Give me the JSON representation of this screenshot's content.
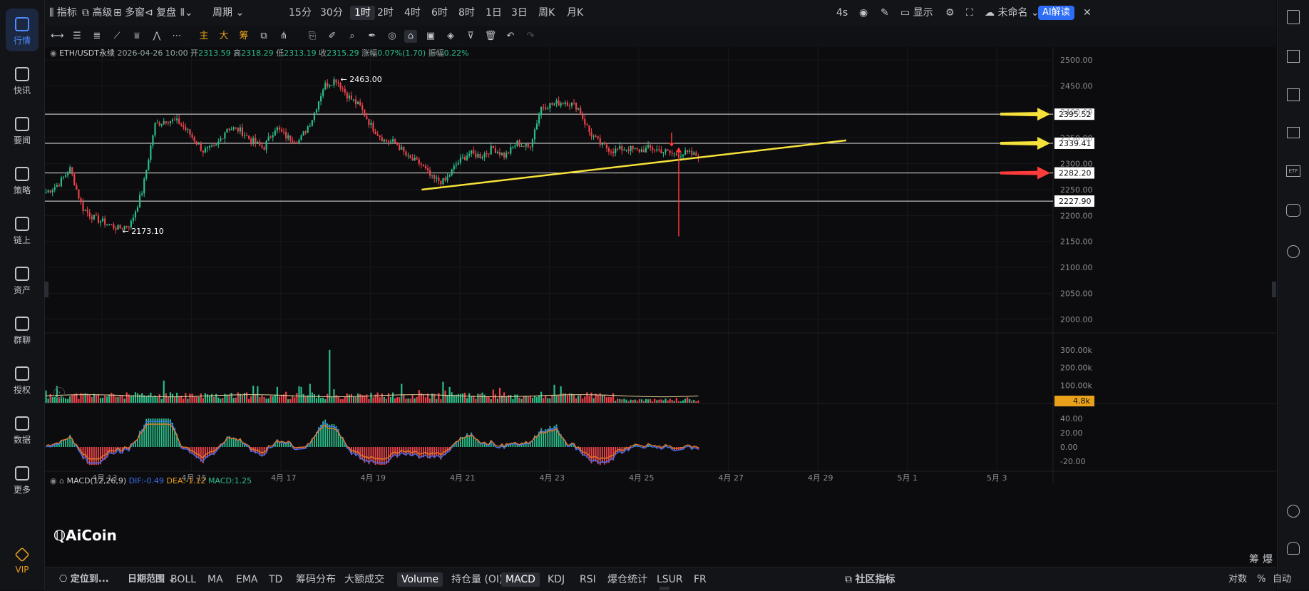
{
  "left_nav": [
    {
      "label": "行情",
      "icon": "bar-chart-icon",
      "active": true
    },
    {
      "label": "快讯",
      "icon": "flash-news-icon"
    },
    {
      "label": "要闻",
      "icon": "document-icon"
    },
    {
      "label": "策略",
      "icon": "robot-icon"
    },
    {
      "label": "链上",
      "icon": "chain-icon"
    },
    {
      "label": "资产",
      "icon": "wallet-icon"
    },
    {
      "label": "群聊",
      "icon": "chat-icon"
    },
    {
      "label": "授权",
      "icon": "authorize-icon"
    },
    {
      "label": "数据",
      "icon": "data-monitor-icon"
    },
    {
      "label": "更多",
      "icon": "more-grid-icon"
    },
    {
      "label": "VIP",
      "icon": "diamond-icon"
    }
  ],
  "top_toolbar": {
    "indicators": "指标",
    "advanced": "高级",
    "multi_window": "多窗",
    "replay": "复盘",
    "period": "周期",
    "timeframes": [
      "15分",
      "30分",
      "1时",
      "2时",
      "4时",
      "6时",
      "8时",
      "1日",
      "3日",
      "周K",
      "月K"
    ],
    "selected_timeframe": "1时",
    "refresh": "4s",
    "display": "显示",
    "layout_name": "未命名",
    "ai_button": "AI解读"
  },
  "instrument": {
    "symbol": "ETH/USDT永续",
    "datetime": "2026-04-26 10:00",
    "open_label": "开",
    "open": "2313.59",
    "high_label": "高",
    "high": "2318.29",
    "low_label": "低",
    "low": "2313.19",
    "close_label": "收",
    "close": "2315.29",
    "change_label": "涨幅",
    "change": "0.07%(1.70)",
    "amplitude_label": "振幅",
    "amplitude": "0.22%"
  },
  "chart_data": {
    "type": "candlestick",
    "interval": "1h",
    "x_labels": [
      "4月 13",
      "4月 15",
      "4月 17",
      "4月 19",
      "4月 21",
      "4月 23",
      "4月 25",
      "4月 27",
      "4月 29",
      "5月 1",
      "5月 3"
    ],
    "y_ticks": [
      2000,
      2050,
      2100,
      2150,
      2200,
      2250,
      2300,
      2350,
      2400,
      2450,
      2500
    ],
    "ylim": [
      1975,
      2525
    ],
    "close_path": [
      [
        "4月 12",
        2245
      ],
      [
        "4月 13",
        2260
      ],
      [
        "4月 13",
        2290
      ],
      [
        "4月 13",
        2215
      ],
      [
        "4月 13",
        2195
      ],
      [
        "4月 14",
        2185
      ],
      [
        "4月 14",
        2175
      ],
      [
        "4月 14",
        2183
      ],
      [
        "4月 14",
        2250
      ],
      [
        "4月 14",
        2375
      ],
      [
        "4月 15",
        2385
      ],
      [
        "4月 15",
        2380
      ],
      [
        "4月 15",
        2355
      ],
      [
        "4月 15",
        2325
      ],
      [
        "4月 16",
        2330
      ],
      [
        "4月 16",
        2370
      ],
      [
        "4月 16",
        2365
      ],
      [
        "4月 16",
        2345
      ],
      [
        "4月 17",
        2330
      ],
      [
        "4月 17",
        2370
      ],
      [
        "4月 17",
        2350
      ],
      [
        "4月 17",
        2345
      ],
      [
        "4月 18",
        2385
      ],
      [
        "4月 18",
        2450
      ],
      [
        "4月 18",
        2463
      ],
      [
        "4月 18",
        2430
      ],
      [
        "4月 18",
        2410
      ],
      [
        "4月 19",
        2370
      ],
      [
        "4月 19",
        2345
      ],
      [
        "4月 19",
        2340
      ],
      [
        "4月 20",
        2310
      ],
      [
        "4月 20",
        2300
      ],
      [
        "4月 20",
        2270
      ],
      [
        "4月 20",
        2265
      ],
      [
        "4月 21",
        2300
      ],
      [
        "4月 21",
        2320
      ],
      [
        "4月 21",
        2315
      ],
      [
        "4月 22",
        2330
      ],
      [
        "4月 22",
        2315
      ],
      [
        "4月 22",
        2340
      ],
      [
        "4月 22",
        2330
      ],
      [
        "4月 22",
        2410
      ],
      [
        "4月 23",
        2415
      ],
      [
        "4月 23",
        2420
      ],
      [
        "4月 23",
        2410
      ],
      [
        "4月 23",
        2360
      ],
      [
        "4月 24",
        2335
      ],
      [
        "4月 24",
        2325
      ],
      [
        "4月 24",
        2330
      ],
      [
        "4月 24",
        2325
      ],
      [
        "4月 25",
        2330
      ],
      [
        "4月 25",
        2325
      ],
      [
        "4月 25",
        2318
      ],
      [
        "4月 26",
        2320
      ],
      [
        "4月 26",
        2315
      ]
    ],
    "annotations": {
      "high_label": "2463.00",
      "high_value": 2463.0,
      "low_label": "2173.10",
      "low_value": 2173.1
    },
    "horizontal_levels": [
      {
        "value": 2395.52,
        "label": "2395.52",
        "arrow_color": "#f5e13a"
      },
      {
        "value": 2339.41,
        "label": "2339.41",
        "arrow_color": "#f5e13a"
      },
      {
        "value": 2282.2,
        "label": "2282.20",
        "arrow_color": "#ff3b3b"
      },
      {
        "value": 2227.9,
        "label": "2227.90",
        "arrow_color": null
      }
    ],
    "trendline": {
      "from": [
        "4月 20",
        2250
      ],
      "to": [
        "4月 29",
        2345
      ],
      "color": "#f5e13a"
    },
    "vertical_marker": {
      "x": "4月 26",
      "top": 2360,
      "bottom": 2160,
      "color": "#ff3b3b"
    },
    "volume": {
      "y_ticks": [
        "300.00k",
        "200.00k",
        "100.00k"
      ],
      "current": "4.8k"
    },
    "macd": {
      "label": "MACD(12,26,9)",
      "dif_label": "DIF:",
      "dif": "-0.49",
      "dea_label": "DEA:",
      "dea": "-1.12",
      "macd_label": "MACD:",
      "macd": "1.25",
      "y_ticks": [
        "40.00",
        "20.00",
        "0.00",
        "-20.00"
      ]
    }
  },
  "right_side_labels": [
    "筹",
    "爆"
  ],
  "watermark": "AiCoin",
  "bottom_toolbar": {
    "locate": "定位到...",
    "date_range": "日期范围",
    "indicators": [
      "BOLL",
      "MA",
      "EMA",
      "TD",
      "筹码分布",
      "大额成交"
    ],
    "sub_indicators": [
      "Volume",
      "持仓量 (OI)",
      "MACD",
      "KDJ",
      "RSI",
      "爆仓统计",
      "LSUR",
      "FR"
    ],
    "selected_sub": [
      "Volume",
      "MACD"
    ],
    "community": "社区指标",
    "log_scale": "对数",
    "percent": "%",
    "auto": "自动"
  },
  "colors": {
    "up": "#2bbf8a",
    "down": "#f0434b",
    "bg": "#0c0c0e",
    "accent": "#4e8cff",
    "ai": "#4e8cff",
    "volume_label_bg": "#e9a11c"
  }
}
